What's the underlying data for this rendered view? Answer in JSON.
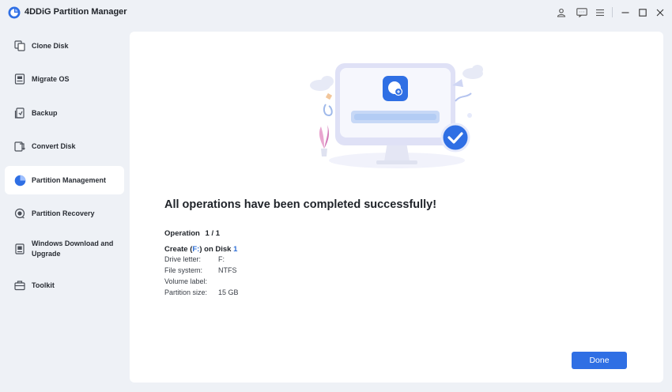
{
  "window": {
    "title": "4DDiG Partition Manager"
  },
  "toolbar_icons": [
    "user-icon",
    "feedback-icon",
    "menu-icon",
    "minimize-icon",
    "maximize-icon",
    "close-icon"
  ],
  "sidebar": {
    "items": [
      {
        "label": "Clone Disk",
        "icon": "clone-disk-icon"
      },
      {
        "label": "Migrate OS",
        "icon": "migrate-os-icon"
      },
      {
        "label": "Backup",
        "icon": "backup-icon"
      },
      {
        "label": "Convert Disk",
        "icon": "convert-disk-icon"
      },
      {
        "label": "Partition Management",
        "icon": "pie-chart-icon",
        "active": true
      },
      {
        "label": "Partition Recovery",
        "icon": "partition-recovery-icon"
      },
      {
        "label": "Windows Download and",
        "label2": "Upgrade",
        "icon": "windows-download-icon"
      },
      {
        "label": "Toolkit",
        "icon": "toolkit-icon"
      }
    ]
  },
  "main": {
    "headline": "All operations have been completed successfully!",
    "operation_label": "Operation",
    "operation_count": "1 / 1",
    "create": {
      "prefix": "Create (",
      "drive": "F:",
      "middle": ") on Disk ",
      "disk": "1"
    },
    "details": [
      {
        "key": "Drive letter:",
        "value": "F:"
      },
      {
        "key": "File system:",
        "value": "NTFS"
      },
      {
        "key": "Volume label:",
        "value": ""
      },
      {
        "key": "Partition size:",
        "value": "15 GB"
      }
    ],
    "done_label": "Done"
  },
  "colors": {
    "accent": "#2f6fe4",
    "background": "#eef1f6",
    "panel": "#ffffff"
  }
}
